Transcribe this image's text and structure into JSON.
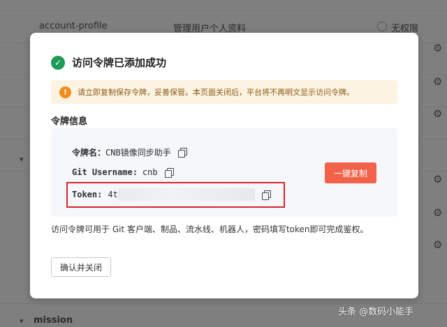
{
  "background": {
    "row1": {
      "name": "account-profile",
      "desc": "管理用户个人资料",
      "permission": "无权限"
    },
    "section_bottom": "mission"
  },
  "modal": {
    "title": "访问令牌已添加成功",
    "warning": "请立即复制保存令牌，妥善保管。本页面关闭后，平台将不再明文显示访问令牌。",
    "section_title": "令牌信息",
    "token_name_label": "令牌名：",
    "token_name_value": "CNB镜像同步助手",
    "git_username_label": "Git Username:",
    "git_username_value": "cnb",
    "token_label": "Token:",
    "token_value_prefix": "4t",
    "copy_all_label": "一键复制",
    "description": "访问令牌可用于 Git 客户端、制品、流水线、机器人，密码填写token即可完成鉴权。",
    "confirm_label": "确认并关闭"
  },
  "watermark": "头条 @数码小能手",
  "colors": {
    "success": "#1e9a57",
    "warning_icon": "#f08c1c",
    "primary_button": "#f2624a",
    "highlight_border": "#d9242b"
  },
  "icons": [
    "check-circle-icon",
    "warning-icon",
    "copy-icon",
    "gear-icon",
    "chevron-down-icon"
  ]
}
